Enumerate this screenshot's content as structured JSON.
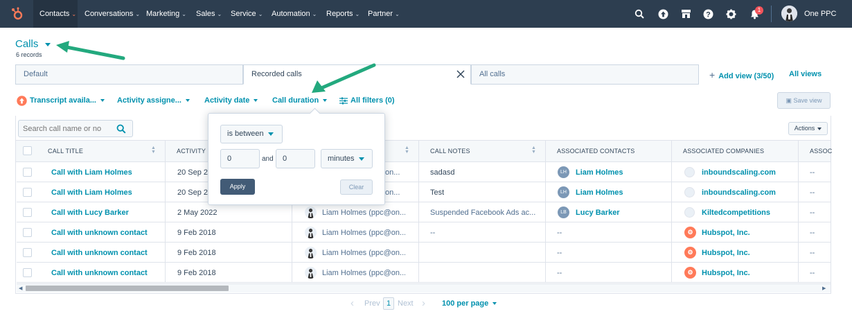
{
  "nav": {
    "items": [
      {
        "label": "Contacts",
        "active": true
      },
      {
        "label": "Conversations"
      },
      {
        "label": "Marketing"
      },
      {
        "label": "Sales"
      },
      {
        "label": "Service"
      },
      {
        "label": "Automation"
      },
      {
        "label": "Reports"
      },
      {
        "label": "Partner"
      }
    ],
    "notification_count": "1",
    "account_name": "One PPC"
  },
  "header": {
    "title": "Calls",
    "record_count": "6 records"
  },
  "tabs": [
    {
      "label": "Default"
    },
    {
      "label": "Recorded calls"
    },
    {
      "label": "All calls"
    }
  ],
  "add_view_label": "Add view (3/50)",
  "all_views_label": "All views",
  "filters": {
    "transcript": "Transcript availa...",
    "activity_assignee": "Activity assigne...",
    "activity_date": "Activity date",
    "call_duration": "Call duration",
    "all_filters": "All filters (0)",
    "save_view": "Save view"
  },
  "search": {
    "placeholder": "Search call name or no"
  },
  "actions_label": "Actions",
  "table": {
    "columns": [
      "CALL TITLE",
      "ACTIVITY D",
      "",
      "CALL NOTES",
      "ASSOCIATED CONTACTS",
      "ASSOCIATED COMPANIES",
      "ASSOC"
    ],
    "rows": [
      {
        "title": "Call with Liam Holmes",
        "date": "20 Sep 20",
        "assignee": "on...",
        "notes": "sadasd",
        "contact": "Liam Holmes",
        "contact_initials": "LH",
        "company": "inboundscaling.com",
        "company_icon": "globe",
        "extra": "--"
      },
      {
        "title": "Call with Liam Holmes",
        "date": "20 Sep 20",
        "assignee": "on...",
        "notes": "Test",
        "contact": "Liam Holmes",
        "contact_initials": "LH",
        "company": "inboundscaling.com",
        "company_icon": "globe",
        "extra": "--"
      },
      {
        "title": "Call with Lucy Barker",
        "date": "2 May 2022",
        "assignee": "Liam Holmes (ppc@on...",
        "notes": "Suspended Facebook Ads ac...",
        "contact": "Lucy Barker",
        "contact_initials": "LB",
        "company": "Kiltedcompetitions",
        "company_icon": "globe",
        "extra": "--"
      },
      {
        "title": "Call with unknown contact",
        "date": "9 Feb 2018",
        "assignee": "Liam Holmes (ppc@on...",
        "notes": "--",
        "contact": "--",
        "contact_initials": "",
        "company": "Hubspot, Inc.",
        "company_icon": "hubspot",
        "extra": "--"
      },
      {
        "title": "Call with unknown contact",
        "date": "9 Feb 2018",
        "assignee": "Liam Holmes (ppc@on...",
        "notes": "",
        "contact": "--",
        "contact_initials": "",
        "company": "Hubspot, Inc.",
        "company_icon": "hubspot",
        "extra": "--"
      },
      {
        "title": "Call with unknown contact",
        "date": "9 Feb 2018",
        "assignee": "Liam Holmes (ppc@on...",
        "notes": "",
        "contact": "--",
        "contact_initials": "",
        "company": "Hubspot, Inc.",
        "company_icon": "hubspot",
        "extra": "--"
      }
    ]
  },
  "popover": {
    "operator": "is between",
    "min": "0",
    "and_label": "and",
    "max": "0",
    "unit": "minutes",
    "apply": "Apply",
    "clear": "Clear"
  },
  "pagination": {
    "prev": "Prev",
    "page": "1",
    "next": "Next",
    "per_page": "100 per page"
  },
  "colors": {
    "nav_bg": "#2d3e50",
    "accent": "#0091ae",
    "hubspot_orange": "#ff7a59",
    "arrow_green": "#23a97e",
    "apply_bg": "#425b76"
  }
}
